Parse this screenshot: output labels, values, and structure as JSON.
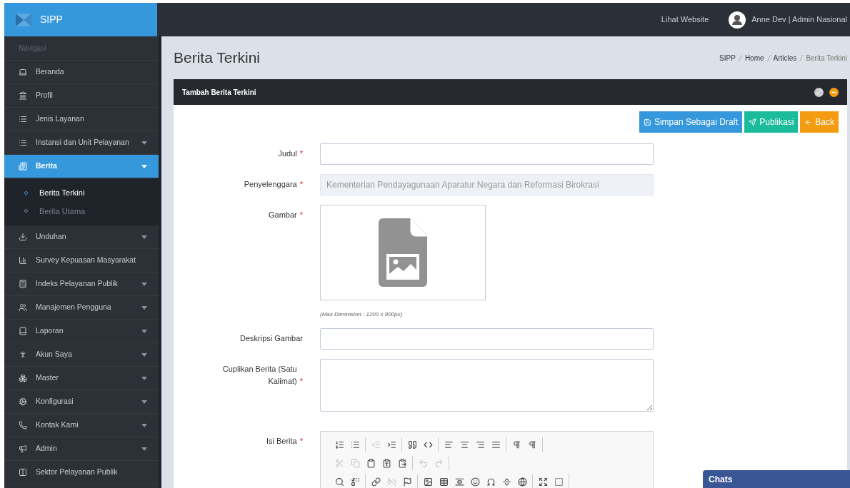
{
  "brand": {
    "name": "SIPP"
  },
  "topbar": {
    "link": "Lihat Website",
    "user": "Anne Dev | Admin Nasional"
  },
  "sidebar": {
    "heading": "Navigasi",
    "items": [
      {
        "label": "Beranda",
        "selected": false,
        "has_submenu": false
      },
      {
        "label": "Profil",
        "selected": false,
        "has_submenu": false
      },
      {
        "label": "Jenis Layanan",
        "selected": false,
        "has_submenu": false
      },
      {
        "label": "Instansi dan Unit Pelayanan",
        "selected": false,
        "has_submenu": true
      },
      {
        "label": "Berita",
        "selected": true,
        "has_submenu": true,
        "expanded": true,
        "children": [
          {
            "label": "Berita Terkini",
            "selected": true
          },
          {
            "label": "Berita Utama",
            "selected": false
          }
        ]
      },
      {
        "label": "Unduhan",
        "selected": false,
        "has_submenu": true
      },
      {
        "label": "Survey Kepuasan Masyarakat",
        "selected": false,
        "has_submenu": false
      },
      {
        "label": "Indeks Pelayanan Publik",
        "selected": false,
        "has_submenu": true
      },
      {
        "label": "Manajemen Pengguna",
        "selected": false,
        "has_submenu": true
      },
      {
        "label": "Laporan",
        "selected": false,
        "has_submenu": true
      },
      {
        "label": "Akun Saya",
        "selected": false,
        "has_submenu": true
      },
      {
        "label": "Master",
        "selected": false,
        "has_submenu": true
      },
      {
        "label": "Konfigurasi",
        "selected": false,
        "has_submenu": true
      },
      {
        "label": "Kontak Kami",
        "selected": false,
        "has_submenu": true
      },
      {
        "label": "Admin",
        "selected": false,
        "has_submenu": true
      },
      {
        "label": "Sektor Pelayanan Publik",
        "selected": false,
        "has_submenu": false
      }
    ]
  },
  "page": {
    "title": "Berita Terkini",
    "breadcrumb": [
      "SIPP",
      "Home",
      "Articles",
      "Berita Terkini"
    ]
  },
  "panel": {
    "title": "Tambah Berita Terkini",
    "buttons": [
      {
        "label": "Simpan Sebagai Draft",
        "kind": "draft"
      },
      {
        "label": "Publikasi",
        "kind": "publish"
      },
      {
        "label": "Back",
        "kind": "back"
      }
    ],
    "fields": [
      {
        "kind": "text",
        "label": "Judul",
        "required_mark": "*"
      },
      {
        "kind": "text",
        "label": "Penyelenggara",
        "required_mark": "*",
        "disabled": true,
        "value": "Kementerian Pendayagunaan Aparatur Negara dan Reformasi Birokrasi"
      },
      {
        "kind": "image",
        "label": "Gambar",
        "required_mark": "*",
        "help": "(Max Dimension : 1200 x 800px)"
      },
      {
        "kind": "text",
        "label": "Deskripsi Gambar"
      },
      {
        "kind": "textarea",
        "label": "Cuplikan Berita (Satu Kalimat)",
        "required_mark": "*"
      },
      {
        "kind": "editor",
        "label": "Isi Berita",
        "required_mark": "*",
        "toolbar": [
          [
            [
              {
                "disabled": false
              },
              {
                "disabled": false
              }
            ],
            [
              {
                "disabled": true
              },
              {
                "disabled": false
              }
            ],
            [
              {
                "disabled": false
              },
              {
                "disabled": false
              }
            ],
            [
              {
                "disabled": false
              },
              {
                "disabled": false
              },
              {
                "disabled": false
              },
              {
                "disabled": false
              }
            ],
            [
              {
                "disabled": false
              },
              {
                "disabled": false
              }
            ]
          ],
          [
            [
              {
                "disabled": true
              },
              {
                "disabled": true
              },
              {
                "disabled": false
              },
              {
                "disabled": false
              },
              {
                "disabled": false
              }
            ],
            [
              {
                "disabled": true
              },
              {
                "disabled": true
              }
            ]
          ],
          [
            [
              {
                "disabled": false
              },
              {
                "disabled": false
              }
            ],
            [
              {
                "disabled": false
              },
              {
                "disabled": true
              },
              {
                "disabled": false
              }
            ],
            [
              {
                "disabled": false
              },
              {
                "disabled": false
              },
              {
                "disabled": false
              },
              {
                "disabled": false
              },
              {
                "disabled": false
              },
              {
                "disabled": false
              },
              {
                "disabled": false
              }
            ],
            [
              {
                "disabled": false
              },
              {
                "disabled": false
              }
            ]
          ]
        ]
      }
    ]
  },
  "chat": {
    "label": "Chats"
  }
}
